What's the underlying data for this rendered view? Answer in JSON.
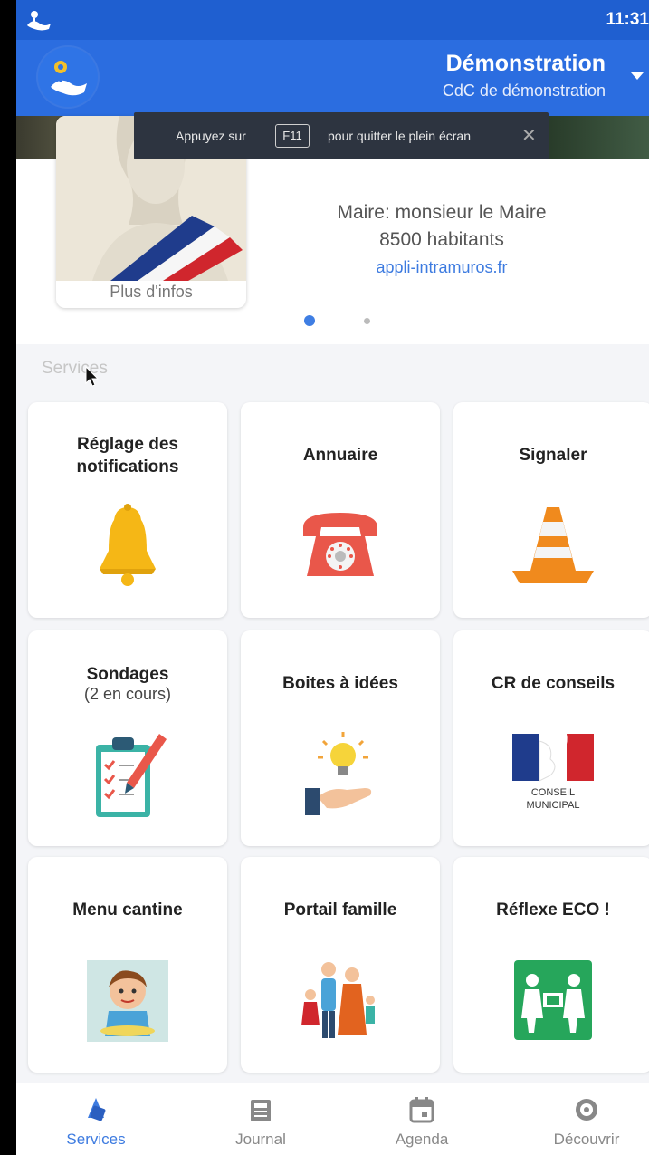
{
  "status_bar": {
    "time": "11:31"
  },
  "app_bar": {
    "title": "Démonstration",
    "subtitle": "CdC de démonstration",
    "icons": {
      "logo": "intramuros-logo-icon",
      "dropdown": "caret-down-icon"
    }
  },
  "fullscreen_toast": {
    "prefix": "Appuyez sur",
    "key": "F11",
    "suffix": "pour quitter le plein écran",
    "close_icon": "close-icon"
  },
  "banner": {
    "more_info": "Plus d'infos",
    "mayor_line": "Maire: monsieur le Maire",
    "population": "8500 habitants",
    "website": "appli-intramuros.fr",
    "carousel": {
      "pages": 2,
      "active": 1
    }
  },
  "services": {
    "title": "Services",
    "tiles": [
      {
        "label": "Réglage des notifications",
        "icon": "bell-icon"
      },
      {
        "label": "Annuaire",
        "icon": "telephone-icon"
      },
      {
        "label": "Signaler",
        "icon": "traffic-cone-icon"
      },
      {
        "label": "Sondages",
        "sub": "(2 en cours)",
        "icon": "clipboard-checklist-icon"
      },
      {
        "label": "Boites à idées",
        "icon": "lightbulb-hand-icon"
      },
      {
        "label": "CR de conseils",
        "icon": "conseil-municipal-icon",
        "icon_caption_1": "CONSEIL",
        "icon_caption_2": "MUNICIPAL"
      },
      {
        "label": "Menu cantine",
        "icon": "child-eating-icon"
      },
      {
        "label": "Portail famille",
        "icon": "family-icon"
      },
      {
        "label": "Réflexe ECO !",
        "icon": "eco-reflex-icon"
      }
    ]
  },
  "bottom_nav": {
    "items": [
      {
        "label": "Services",
        "icon": "services-icon",
        "active": true
      },
      {
        "label": "Journal",
        "icon": "newspaper-icon",
        "active": false
      },
      {
        "label": "Agenda",
        "icon": "calendar-icon",
        "active": false
      },
      {
        "label": "Découvrir",
        "icon": "compass-icon",
        "active": false
      }
    ]
  },
  "colors": {
    "primary": "#2b6de0",
    "status_bar": "#1f5fd0",
    "accent_link": "#3d7be0",
    "background": "#f4f5f8"
  }
}
